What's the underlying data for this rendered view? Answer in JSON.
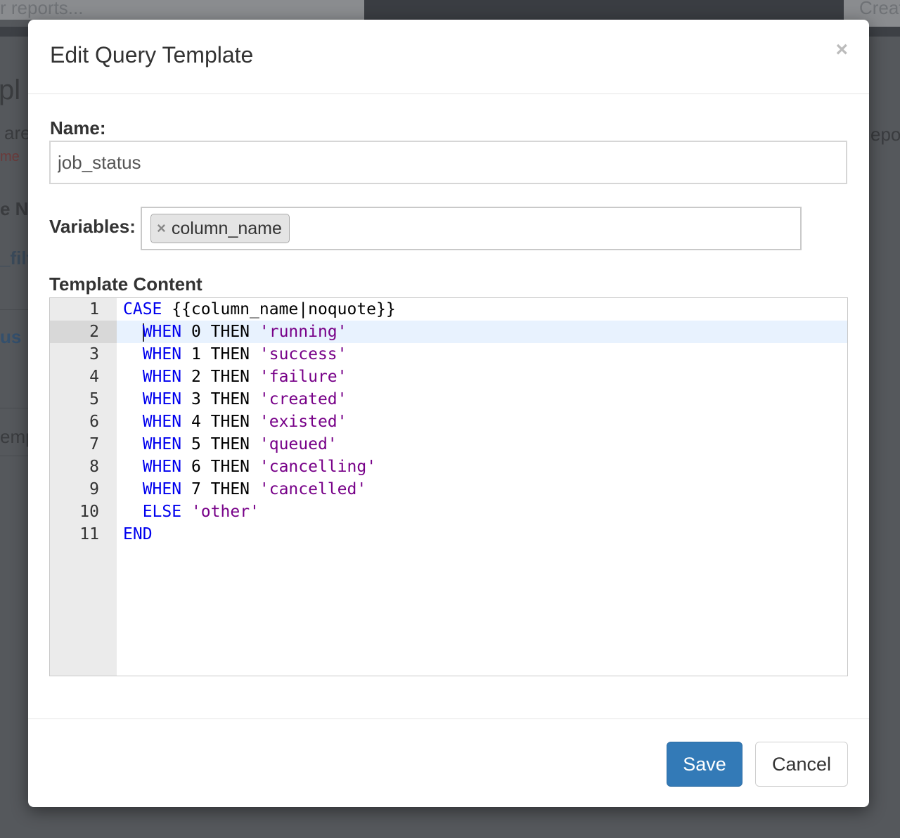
{
  "background": {
    "search_placeholder": "r reports...",
    "create_label": "Creat",
    "fragments": [
      "pl",
      "are",
      "me",
      "e N",
      "_filt",
      "us",
      "emp",
      "epor"
    ]
  },
  "modal": {
    "title": "Edit Query Template",
    "close_glyph": "×",
    "name_label": "Name:",
    "name_value": "job_status",
    "variables_label": "Variables:",
    "variables": [
      {
        "remove_glyph": "×",
        "label": "column_name"
      }
    ],
    "template_label": "Template Content",
    "code": {
      "active_line": 2,
      "lines": [
        {
          "num": "1",
          "indent": "",
          "kw": "CASE",
          "plain": " {{column_name|noquote}}",
          "str": ""
        },
        {
          "num": "2",
          "indent": "  ",
          "kw": "WHEN",
          "plain": " 0 THEN ",
          "str": "'running'"
        },
        {
          "num": "3",
          "indent": "  ",
          "kw": "WHEN",
          "plain": " 1 THEN ",
          "str": "'success'"
        },
        {
          "num": "4",
          "indent": "  ",
          "kw": "WHEN",
          "plain": " 2 THEN ",
          "str": "'failure'"
        },
        {
          "num": "5",
          "indent": "  ",
          "kw": "WHEN",
          "plain": " 3 THEN ",
          "str": "'created'"
        },
        {
          "num": "6",
          "indent": "  ",
          "kw": "WHEN",
          "plain": " 4 THEN ",
          "str": "'existed'"
        },
        {
          "num": "7",
          "indent": "  ",
          "kw": "WHEN",
          "plain": " 5 THEN ",
          "str": "'queued'"
        },
        {
          "num": "8",
          "indent": "  ",
          "kw": "WHEN",
          "plain": " 6 THEN ",
          "str": "'cancelling'"
        },
        {
          "num": "9",
          "indent": "  ",
          "kw": "WHEN",
          "plain": " 7 THEN ",
          "str": "'cancelled'"
        },
        {
          "num": "10",
          "indent": "  ",
          "kw": "ELSE",
          "plain": " ",
          "str": "'other'"
        },
        {
          "num": "11",
          "indent": "",
          "kw": "END",
          "plain": "",
          "str": ""
        }
      ]
    },
    "save_label": "Save",
    "cancel_label": "Cancel"
  },
  "colors": {
    "primary": "#337ab7",
    "keyword": "#0000ee",
    "string": "#770088",
    "active_line": "#e8f2fe"
  }
}
